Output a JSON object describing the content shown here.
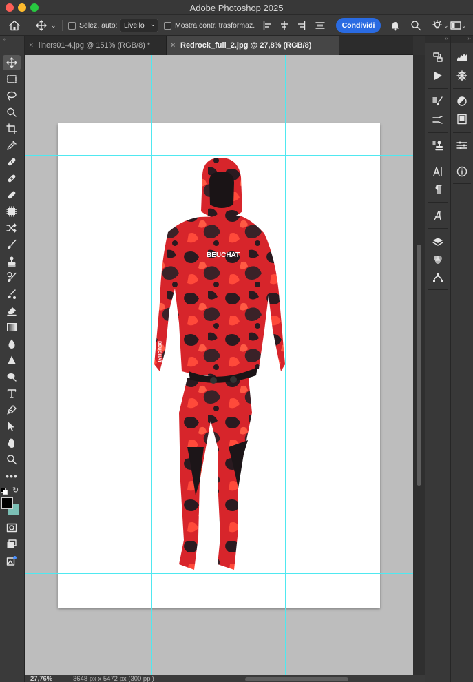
{
  "window": {
    "title": "Adobe Photoshop 2025"
  },
  "options_bar": {
    "auto_select_label": "Selez. auto:",
    "auto_select_target": "Livello",
    "show_transform_label": "Mostra contr. trasformaz.",
    "share_label": "Condividi"
  },
  "tabs": [
    {
      "label": "liners01-4.jpg @ 151% (RGB/8) *",
      "close": "×"
    },
    {
      "label": "Redrock_full_2.jpg @ 27,8% (RGB/8)",
      "close": "×"
    }
  ],
  "product": {
    "brand_chest": "BEUCHAT",
    "brand_sleeve": "BEUCHAT"
  },
  "status": {
    "zoom": "27,76%",
    "doc_size": "3648 px x 5472 px (300 ppi)"
  },
  "colors": {
    "foreground": "#000000",
    "background": "#7bbfb5",
    "guides": "#4fe8f0",
    "share_button": "#2a6be2",
    "suit_red": "#e0262c"
  },
  "tools": [
    "move",
    "marquee",
    "lasso",
    "quick-select",
    "crop",
    "eyedropper",
    "spot-healing",
    "healing",
    "patch",
    "content-aware-move",
    "red-eye",
    "brush",
    "clone-stamp",
    "history-brush",
    "mixer-brush",
    "eraser",
    "gradient",
    "blur",
    "sharpen",
    "dodge",
    "type",
    "pen",
    "path-select",
    "hand",
    "zoom",
    "more"
  ]
}
